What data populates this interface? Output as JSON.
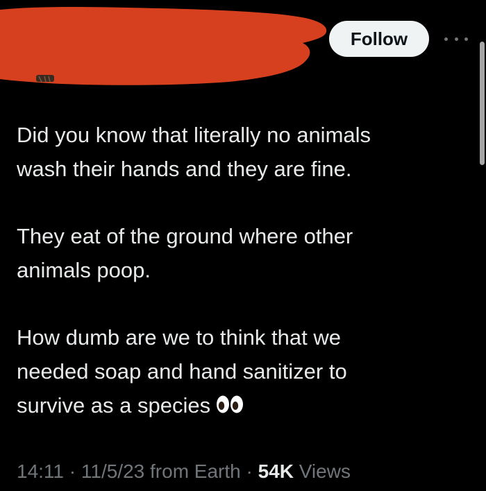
{
  "header": {
    "follow_label": "Follow",
    "redaction_color": "#d7401f",
    "more_icon": "more-horizontal-icon"
  },
  "tweet": {
    "paragraphs": [
      "Did you know that literally no animals\nwash their hands and they are fine.",
      "They eat of the ground where other\nanimals poop.",
      "How dumb are we to think that we\nneeded soap and hand sanitizer to\nsurvive as a species"
    ],
    "emoji": "eyes-emoji"
  },
  "meta": {
    "time": "14:11",
    "separator": "·",
    "date": "11/5/23",
    "location": "from Earth",
    "views_count": "54K",
    "views_label": "Views"
  },
  "colors": {
    "background": "#000000",
    "text": "#e7e9ea",
    "muted": "#71767b",
    "follow_bg": "#eff3f4"
  }
}
